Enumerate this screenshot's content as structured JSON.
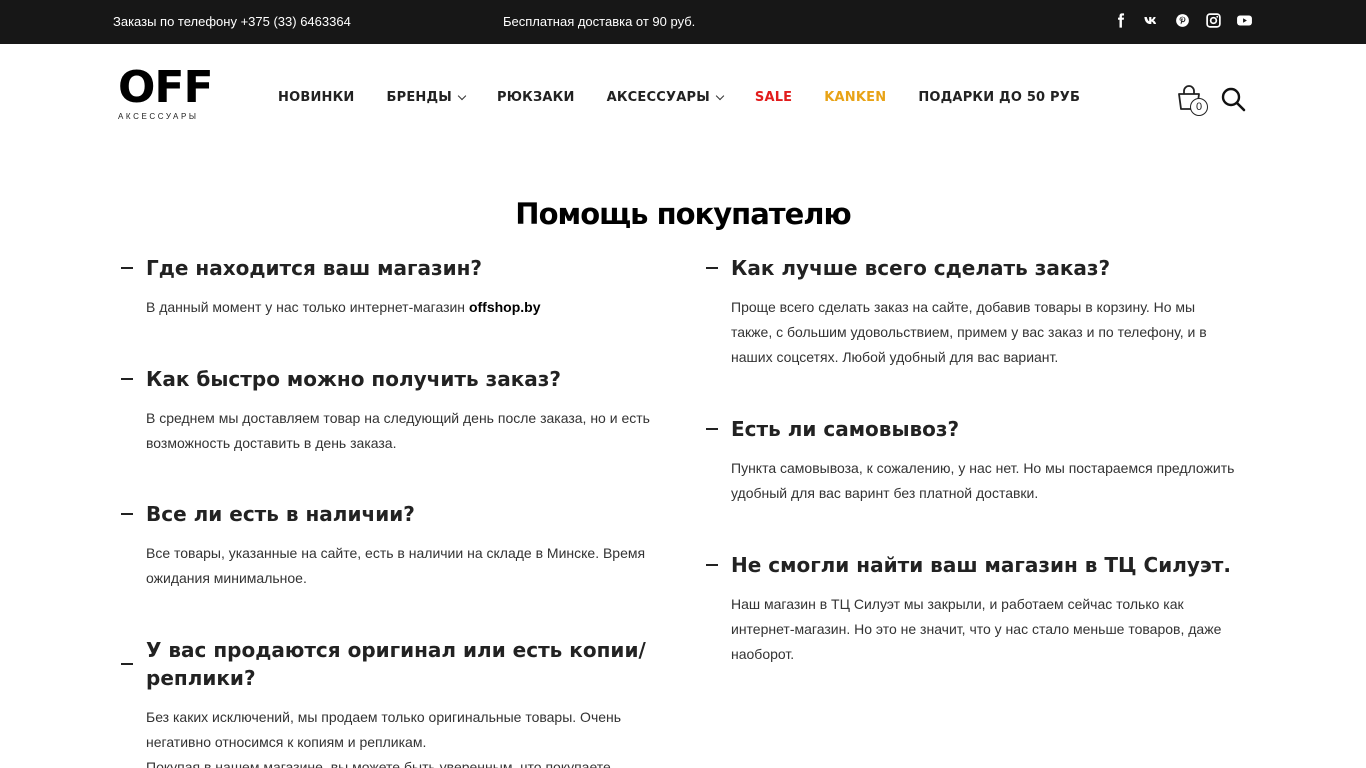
{
  "topbar": {
    "phone": "Заказы по телефону +375 (33) 6463364",
    "delivery": "Бесплатная доставка от 90 руб.",
    "social": [
      "facebook-icon",
      "vk-icon",
      "pinterest-icon",
      "instagram-icon",
      "youtube-icon"
    ]
  },
  "logo": {
    "main": "OFF",
    "sub": "АКСЕССУАРЫ"
  },
  "nav": {
    "items": [
      {
        "label": "НОВИНКИ"
      },
      {
        "label": "БРЕНДЫ"
      },
      {
        "label": "РЮКЗАКИ"
      },
      {
        "label": "АКСЕССУАРЫ"
      },
      {
        "label": "SALE"
      },
      {
        "label": "KANKEN"
      },
      {
        "label": "ПОДАРКИ ДО 50 РУБ"
      }
    ]
  },
  "cart": {
    "count": "0"
  },
  "page": {
    "title": "Помощь покупателю"
  },
  "faq": {
    "left": [
      {
        "q": "Где находится ваш магазин?",
        "a": "В данный момент у нас только интернет-магазин ",
        "a_bold": "offshop.by"
      },
      {
        "q": "Как быстро можно получить заказ?",
        "a": "В среднем мы доставляем товар на следующий день после заказа, но и есть возможность доставить в день заказа."
      },
      {
        "q": "Все ли есть в наличии?",
        "a": "Все товары, указанные на сайте, есть в наличии на складе в Минске. Время ожидания минимальное."
      },
      {
        "q": "У вас продаются оригинал или есть копии/реплики?",
        "a": "Без каких исключений, мы продаем только оригинальные товары. Очень негативно относимся к копиям и репликам.",
        "a2": "Покупая в нашем магазине, вы можете быть уверенным, что покупаете"
      }
    ],
    "right": [
      {
        "q": "Как лучше всего сделать заказ?",
        "a": "Проще всего сделать заказ на сайте, добавив товары в корзину. Но мы также, с  большим удовольствием, примем у вас заказ и по телефону, и в наших соцсетях. Любой удобный для вас вариант."
      },
      {
        "q": "Есть ли самовывоз?",
        "a": "Пункта самовывоза, к сожалению, у нас нет. Но мы постараемся предложить удобный для вас варинт без платной доставки."
      },
      {
        "q": "Не смогли найти ваш магазин в ТЦ Силуэт.",
        "a": "Наш магазин в ТЦ Силуэт мы закрыли, и работаем сейчас только как интернет-магазин. Но это не значит, что у нас стало меньше товаров, даже наоборот."
      }
    ]
  },
  "colors": {
    "topbar": "#171717",
    "sale": "#e21c1c",
    "kanken": "#e8a317"
  }
}
